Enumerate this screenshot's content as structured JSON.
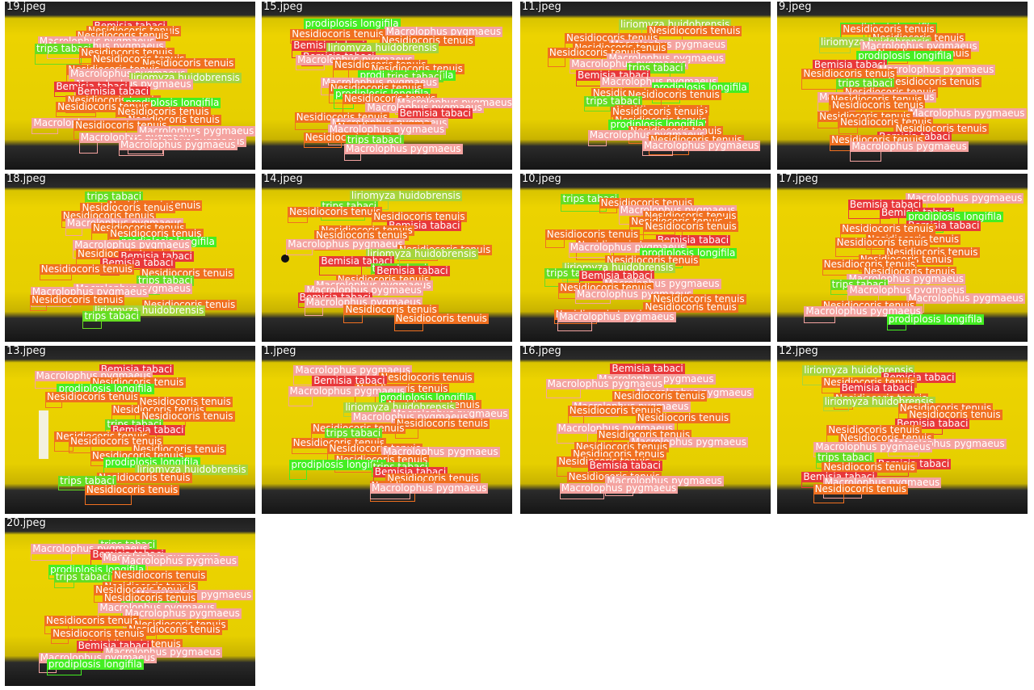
{
  "colors": {
    "Nesidiocoris tenuis": "#f07020",
    "Macrolophus pygmaeus": "#f4a3a0",
    "Bemisia tabaci": "#e8383a",
    "trips tabaci": "#66dd22",
    "prodiplosis longifila": "#44ee22",
    "liriomyza huidobrensis": "#a6d43c",
    "Trialeurodes vaporariorum": "#f09040"
  },
  "tiles": [
    {
      "title": "19.jpeg",
      "labels": [
        "Bemisia tabaci",
        "Nesidiocoris tenuis",
        "Nesidiocoris tenuis",
        "Macrolophus pygmaeus",
        "Macrolophus pygmaeus",
        "trips tabaci",
        "Nesidiocoris tenuis",
        "Nesidiocoris tenuis",
        "Nesidiocoris tenuis",
        "Nesidiocoris tenuis",
        "Macrolophus pygmaeus",
        "liriomyza huidobrensis",
        "Macrolophus pygmaeus",
        "Bemisia tabaci",
        "Bemisia tabaci",
        "Nesidiocoris tenuis",
        "prodiplosis longifila",
        "Nesidiocoris tenuis",
        "Nesidiocoris tenuis",
        "Nesidiocoris tenuis",
        "Macrolophus pygmaeus",
        "Nesidiocoris tenuis",
        "Macrolophus pygmaeus",
        "Macrolophus pygmaeus",
        "Macrolophus pygmaeus",
        "Macrolophus pygmaeus"
      ]
    },
    {
      "title": "15.jpeg",
      "labels": [
        "prodiplosis longifila",
        "Macrolophus pygmaeus",
        "Nesidiocoris tenuis",
        "Nesidiocoris tenuis",
        "Bemisia tabaci",
        "liriomyza huidobrensis",
        "Bemisia tabaci",
        "Macrolophus pygmaeus",
        "Nesidiocoris tenuis",
        "Nesidiocoris tenuis",
        "prodiplosis longifila",
        "trips tabaci",
        "Macrolophus pygmaeus",
        "Nesidiocoris tenuis",
        "prodiplosis longifila",
        "Nesidiocoris tenuis",
        "Macrolophus pygmaeus",
        "Macrolophus pygmaeus",
        "Bemisia tabaci",
        "Nesidiocoris tenuis",
        "Macrolophus pygmaeus",
        "Nesidiocoris tenuis",
        "Macrolophus pygmaeus",
        "Nesidiocoris tenuis",
        "trips tabaci",
        "Macrolophus pygmaeus"
      ]
    },
    {
      "title": "11.jpeg",
      "labels": [
        "liriomyza huidobrensis",
        "Nesidiocoris tenuis",
        "Nesidiocoris tenuis",
        "Macrolophus pygmaeus",
        "Nesidiocoris tenuis",
        "Nesidiocoris tenuis",
        "Macrolophus pygmaeus",
        "Macrolophus pygmaeus",
        "trips tabaci",
        "Bemisia tabaci",
        "Macrolophus pygmaeus",
        "prodiplosis longifila",
        "Nesidiocoris tenuis",
        "Nesidiocoris tenuis",
        "trips tabaci",
        "Nesidiocoris tenuis",
        "Nesidiocoris tenuis",
        "Nesidiocoris tenuis",
        "prodiplosis longifila",
        "Nesidiocoris tenuis",
        "Macrolophus pygmaeus",
        "Nesidiocoris tenuis",
        "Macrolophus pygmaeus"
      ]
    },
    {
      "title": "9.jpeg",
      "labels": [
        "prodiplosis longifila",
        "Nesidiocoris tenuis",
        "Nesidiocoris tenuis",
        "liriomyza huidobrensis",
        "Macrolophus pygmaeus",
        "Nesidiocoris tenuis",
        "prodiplosis longifila",
        "Bemisia tabaci",
        "Macrolophus pygmaeus",
        "Nesidiocoris tenuis",
        "Nesidiocoris tenuis",
        "trips tabaci",
        "Nesidiocoris tenuis",
        "Macrolophus pygmaeus",
        "Nesidiocoris tenuis",
        "Nesidiocoris tenuis",
        "Macrolophus pygmaeus",
        "Nesidiocoris tenuis",
        "Nesidiocoris tenuis",
        "Nesidiocoris tenuis",
        "Bemisia tabaci",
        "Nesidiocoris tenuis",
        "Macrolophus pygmaeus"
      ]
    },
    {
      "title": "18.jpeg",
      "labels": [
        "trips tabaci",
        "Nesidiocoris tenuis",
        "Nesidiocoris tenuis",
        "Nesidiocoris tenuis",
        "Macrolophus pygmaeus",
        "Nesidiocoris tenuis",
        "Nesidiocoris tenuis",
        "prodiplosis longifila",
        "Macrolophus pygmaeus",
        "Nesidiocoris tenuis",
        "Bemisia tabaci",
        "Bemisia tabaci",
        "Nesidiocoris tenuis",
        "Nesidiocoris tenuis",
        "trips tabaci",
        "Macrolophus pygmaeus",
        "Macrolophus pygmaeus",
        "Nesidiocoris tenuis",
        "Nesidiocoris tenuis",
        "liriomyza huidobrensis",
        "trips tabaci"
      ]
    },
    {
      "title": "14.jpeg",
      "labels": [
        "liriomyza huidobrensis",
        "trips tabaci",
        "Nesidiocoris tenuis",
        "Nesidiocoris tenuis",
        "Bemisia tabaci",
        "Nesidiocoris tenuis",
        "Nesidiocoris tenuis",
        "Macrolophus pygmaeus",
        "Nesidiocoris tenuis",
        "liriomyza huidobrensis",
        "Bemisia tabaci",
        "trips tabaci",
        "Bemisia tabaci",
        "Nesidiocoris tenuis",
        "Macrolophus pygmaeus",
        "Macrolophus pygmaeus",
        "Bemisia tabaci",
        "Macrolophus pygmaeus",
        "Nesidiocoris tenuis",
        "Nesidiocoris tenuis"
      ]
    },
    {
      "title": "10.jpeg",
      "labels": [
        "trips tabaci",
        "Nesidiocoris tenuis",
        "Macrolophus pygmaeus",
        "Nesidiocoris tenuis",
        "Nesidiocoris tenuis",
        "Nesidiocoris tenuis",
        "Nesidiocoris tenuis",
        "Bemisia tabaci",
        "Nesidiocoris tenuis",
        "Macrolophus pygmaeus",
        "prodiplosis longifila",
        "Nesidiocoris tenuis",
        "liriomyza huidobrensis",
        "trips tabaci",
        "Bemisia tabaci",
        "Macrolophus pygmaeus",
        "Nesidiocoris tenuis",
        "Macrolophus pygmaeus",
        "Nesidiocoris tenuis",
        "Nesidiocoris tenuis",
        "Nesidiocoris tenuis",
        "Macrolophus pygmaeus"
      ]
    },
    {
      "title": "17.jpeg",
      "labels": [
        "Macrolophus pygmaeus",
        "Bemisia tabaci",
        "Bemisia tabaci",
        "prodiplosis longifila",
        "Bemisia tabaci",
        "Nesidiocoris tenuis",
        "Nesidiocoris tenuis",
        "Nesidiocoris tenuis",
        "Nesidiocoris tenuis",
        "Nesidiocoris tenuis",
        "Nesidiocoris tenuis",
        "Nesidiocoris tenuis",
        "Macrolophus pygmaeus",
        "trips tabaci",
        "Macrolophus pygmaeus",
        "Macrolophus pygmaeus",
        "Nesidiocoris tenuis",
        "Macrolophus pygmaeus",
        "prodiplosis longifila"
      ]
    },
    {
      "title": "13.jpeg",
      "labels": [
        "Bemisia tabaci",
        "Macrolophus pygmaeus",
        "Nesidiocoris tenuis",
        "prodiplosis longifila",
        "Nesidiocoris tenuis",
        "Nesidiocoris tenuis",
        "Nesidiocoris tenuis",
        "Nesidiocoris tenuis",
        "trips tabaci",
        "Bemisia tabaci",
        "Nesidiocoris tenuis",
        "Nesidiocoris tenuis",
        "Nesidiocoris tenuis",
        "Nesidiocoris tenuis",
        "prodiplosis longifila",
        "liriomyza huidobrensis",
        "Nesidiocoris tenuis",
        "trips tabaci",
        "Nesidiocoris tenuis"
      ]
    },
    {
      "title": "1.jpeg",
      "labels": [
        "Macrolophus pygmaeus",
        "Nesidiocoris tenuis",
        "Bemisia tabaci",
        "Nesidiocoris tenuis",
        "Macrolophus pygmaeus",
        "prodiplosis longifila",
        "Nesidiocoris tenuis",
        "liriomyza huidobrensis",
        "Macrolophus pygmaeus",
        "Macrolophus pygmaeus",
        "Nesidiocoris tenuis",
        "Nesidiocoris tenuis",
        "trips tabaci",
        "Nesidiocoris tenuis",
        "Nesidiocoris tenuis",
        "Macrolophus pygmaeus",
        "Nesidiocoris tenuis",
        "prodiplosis longifila",
        "trips tabaci",
        "Bemisia tabaci",
        "Nesidiocoris tenuis",
        "Nesidiocoris tenuis",
        "Macrolophus pygmaeus"
      ]
    },
    {
      "title": "16.jpeg",
      "labels": [
        "Bemisia tabaci",
        "Macrolophus pygmaeus",
        "Macrolophus pygmaeus",
        "Macrolophus pygmaeus",
        "Nesidiocoris tenuis",
        "Macrolophus pygmaeus",
        "Nesidiocoris tenuis",
        "Nesidiocoris tenuis",
        "Macrolophus pygmaeus",
        "Nesidiocoris tenuis",
        "Macrolophus pygmaeus",
        "Nesidiocoris tenuis",
        "Nesidiocoris tenuis",
        "Nesidiocoris tenuis",
        "Bemisia tabaci",
        "Nesidiocoris tenuis",
        "Macrolophus pygmaeus",
        "Macrolophus pygmaeus"
      ]
    },
    {
      "title": "12.jpeg",
      "labels": [
        "liriomyza huidobrensis",
        "Bemisia tabaci",
        "Nesidiocoris tenuis",
        "Bemisia tabaci",
        "Nesidiocoris tenuis",
        "liriomyza huidobrensis",
        "Nesidiocoris tenuis",
        "Nesidiocoris tenuis",
        "Bemisia tabaci",
        "Nesidiocoris tenuis",
        "Nesidiocoris tenuis",
        "Macrolophus pygmaeus",
        "Macrolophus pygmaeus",
        "trips tabaci",
        "Bemisia tabaci",
        "Nesidiocoris tenuis",
        "Bemisia tabaci",
        "Macrolophus pygmaeus",
        "Nesidiocoris tenuis"
      ]
    },
    {
      "title": "20.jpeg",
      "labels": [
        "trips tabaci",
        "Macrolophus pygmaeus",
        "Bemisia tabaci",
        "Macrolophus pygmaeus",
        "Macrolophus pygmaeus",
        "prodiplosis longifila",
        "Nesidiocoris tenuis",
        "trips tabaci",
        "Nesidiocoris tenuis",
        "Nesidiocoris tenuis",
        "Macrolophus pygmaeus",
        "Nesidiocoris tenuis",
        "trips tabaci",
        "Macrolophus pygmaeus",
        "Macrolophus pygmaeus",
        "Nesidiocoris tenuis",
        "Nesidiocoris tenuis",
        "Nesidiocoris tenuis",
        "Nesidiocoris tenuis",
        "Nesidiocoris tenuis",
        "Bemisia tabaci",
        "Macrolophus pygmaeus",
        "Macrolophus pygmaeus",
        "prodiplosis longifila"
      ]
    }
  ]
}
